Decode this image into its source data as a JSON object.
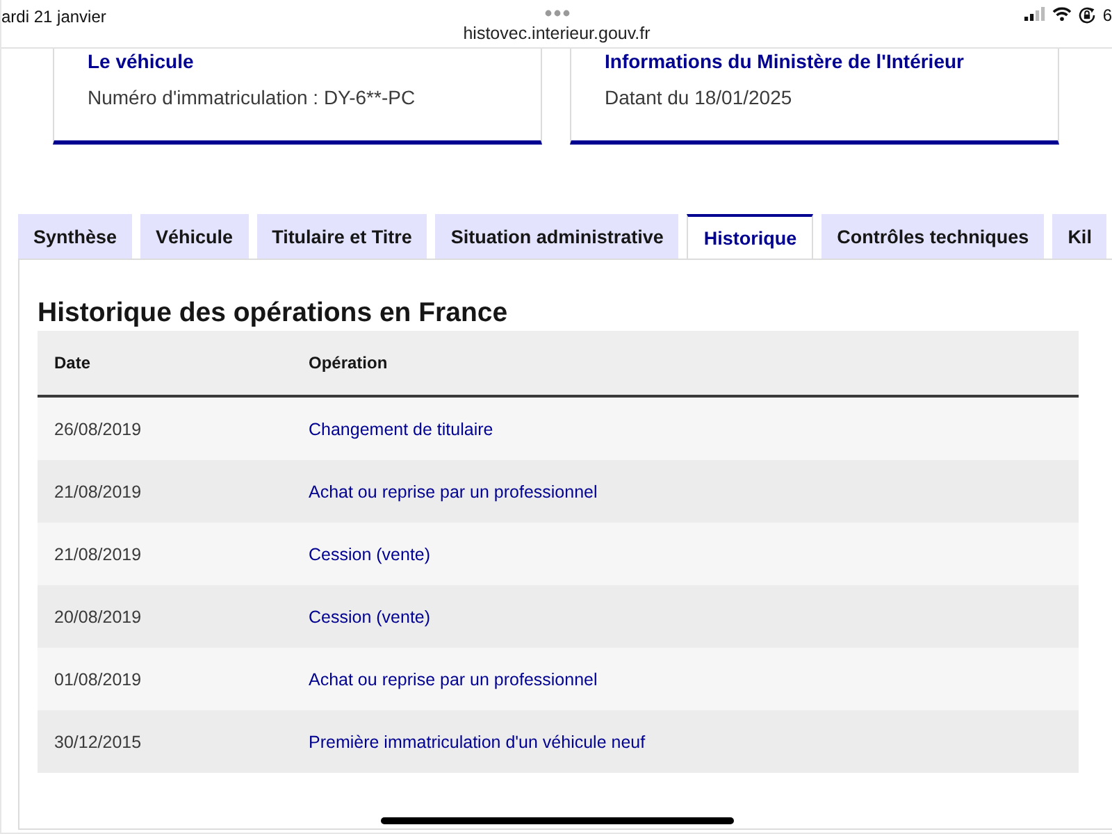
{
  "status_bar": {
    "date": "ardi 21 janvier",
    "url": "histovec.interieur.gouv.fr",
    "battery": "6"
  },
  "cards": [
    {
      "title": "Le véhicule",
      "text": "Numéro d'immatriculation : DY-6**-PC"
    },
    {
      "title": "Informations du Ministère de l'Intérieur",
      "text": "Datant du 18/01/2025"
    }
  ],
  "tabs": [
    {
      "label": "Synthèse",
      "selected": false
    },
    {
      "label": "Véhicule",
      "selected": false
    },
    {
      "label": "Titulaire et Titre",
      "selected": false
    },
    {
      "label": "Situation administrative",
      "selected": false
    },
    {
      "label": "Historique",
      "selected": true
    },
    {
      "label": "Contrôles techniques",
      "selected": false
    },
    {
      "label": "Kil",
      "selected": false
    }
  ],
  "section": {
    "title": "Historique des opérations en France",
    "table": {
      "columns": [
        "Date",
        "Opération"
      ],
      "rows": [
        {
          "date": "26/08/2019",
          "operation": "Changement de titulaire"
        },
        {
          "date": "21/08/2019",
          "operation": "Achat ou reprise par un professionnel"
        },
        {
          "date": "21/08/2019",
          "operation": "Cession (vente)"
        },
        {
          "date": "20/08/2019",
          "operation": "Cession (vente)"
        },
        {
          "date": "01/08/2019",
          "operation": "Achat ou reprise par un professionnel"
        },
        {
          "date": "30/12/2015",
          "operation": "Première immatriculation d'un véhicule neuf"
        }
      ]
    }
  }
}
